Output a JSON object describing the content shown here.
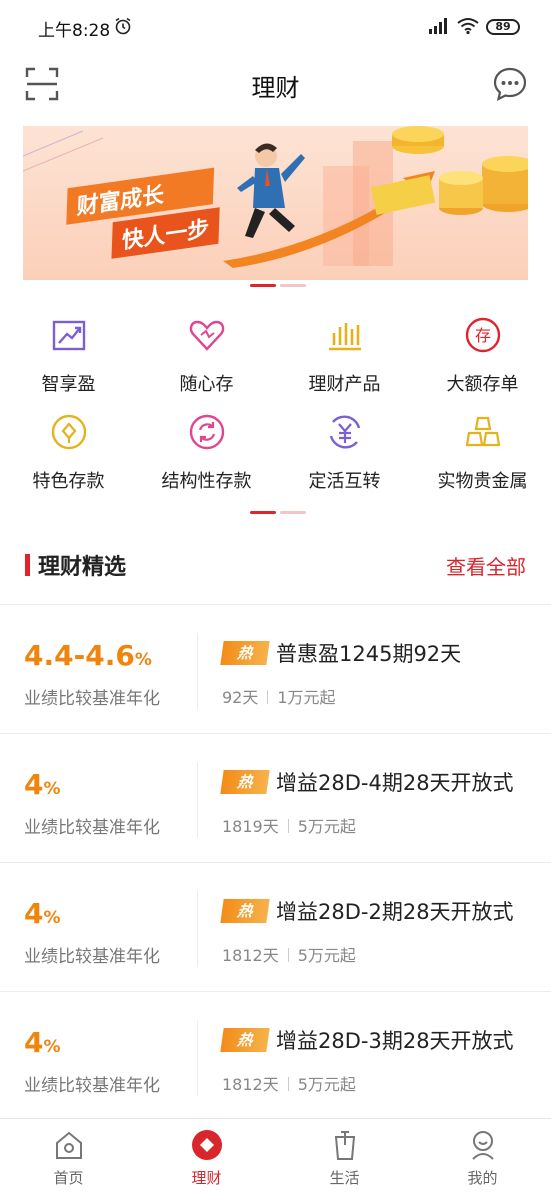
{
  "status": {
    "time": "上午8:28",
    "battery": "89"
  },
  "nav": {
    "title": "理财"
  },
  "banner": {
    "line1": "财富成长",
    "line2": "快人一步"
  },
  "quick_items": [
    {
      "label": "智享盈",
      "icon": "trend-chart-icon",
      "color": "#7b5fd6"
    },
    {
      "label": "随心存",
      "icon": "heart-icon",
      "color": "#e0458f"
    },
    {
      "label": "理财产品",
      "icon": "bar-chart-icon",
      "color": "#e5b21d"
    },
    {
      "label": "大额存单",
      "icon": "deposit-stamp-icon",
      "color": "#e2232a"
    },
    {
      "label": "特色存款",
      "icon": "coin-diamond-icon",
      "color": "#e5b21d"
    },
    {
      "label": "结构性存款",
      "icon": "refresh-circle-icon",
      "color": "#e0458f"
    },
    {
      "label": "定活互转",
      "icon": "yuan-exchange-icon",
      "color": "#7b5fd6"
    },
    {
      "label": "实物贵金属",
      "icon": "gold-bars-icon",
      "color": "#e5b21d"
    }
  ],
  "section": {
    "title": "理财精选",
    "view_all": "查看全部"
  },
  "products": [
    {
      "rate": "4.4-4.6",
      "rate_unit": "%",
      "rate_label": "业绩比较基准年化",
      "badge": "热",
      "name": "普惠盈1245期92天",
      "term": "92天",
      "min": "1万元起"
    },
    {
      "rate": "4",
      "rate_unit": "%",
      "rate_label": "业绩比较基准年化",
      "badge": "热",
      "name": "增益28D-4期28天开放式",
      "term": "1819天",
      "min": "5万元起"
    },
    {
      "rate": "4",
      "rate_unit": "%",
      "rate_label": "业绩比较基准年化",
      "badge": "热",
      "name": "增益28D-2期28天开放式",
      "term": "1812天",
      "min": "5万元起"
    },
    {
      "rate": "4",
      "rate_unit": "%",
      "rate_label": "业绩比较基准年化",
      "badge": "热",
      "name": "增益28D-3期28天开放式",
      "term": "1812天",
      "min": "5万元起"
    }
  ],
  "tabs": [
    {
      "label": "首页",
      "icon": "home-icon",
      "active": false
    },
    {
      "label": "理财",
      "icon": "wealth-diamond-icon",
      "active": true
    },
    {
      "label": "生活",
      "icon": "cup-icon",
      "active": false
    },
    {
      "label": "我的",
      "icon": "user-icon",
      "active": false
    }
  ],
  "colors": {
    "accent": "#d9262c",
    "rate": "#f0850e",
    "badge": "#f28c1a"
  }
}
